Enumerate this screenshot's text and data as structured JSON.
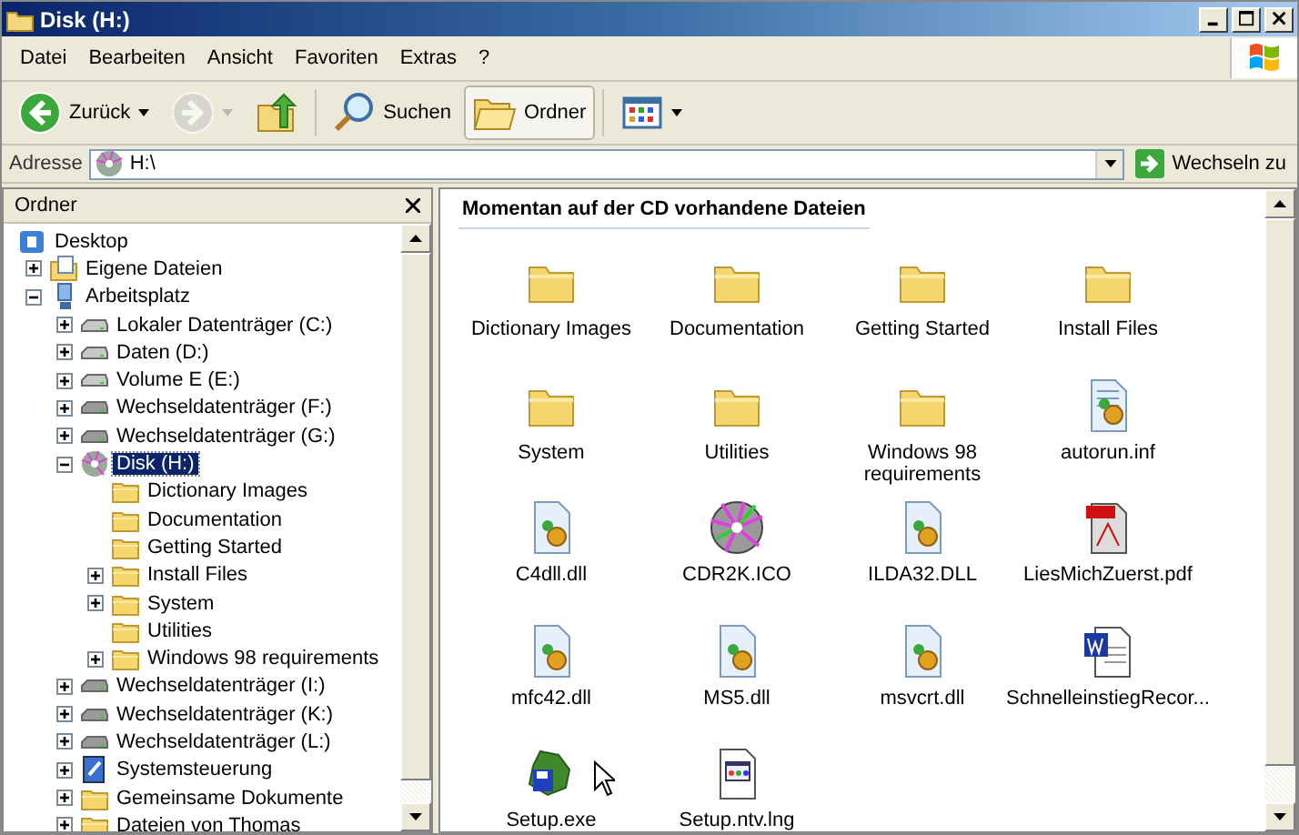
{
  "window": {
    "title": "Disk (H:)"
  },
  "menu": [
    "Datei",
    "Bearbeiten",
    "Ansicht",
    "Favoriten",
    "Extras",
    "?"
  ],
  "toolbar": [
    {
      "kind": "back",
      "label": "Zurück",
      "disabled": false,
      "pressed": false
    },
    {
      "kind": "forward",
      "disabled": true,
      "pressed": false
    },
    {
      "kind": "up",
      "disabled": false,
      "pressed": false
    },
    {
      "kind": "separator"
    },
    {
      "kind": "search",
      "label": "Suchen",
      "disabled": false,
      "pressed": false
    },
    {
      "kind": "folders",
      "label": "Ordner",
      "disabled": false,
      "pressed": true
    },
    {
      "kind": "separator"
    },
    {
      "kind": "views",
      "disabled": false,
      "pressed": false
    }
  ],
  "address": {
    "label": "Adresse",
    "value": "H:\\",
    "go": "Wechseln zu"
  },
  "folders_pane": {
    "title": "Ordner",
    "tree": [
      {
        "label": "Desktop",
        "kind": "desktop",
        "has_children": false,
        "selected": false,
        "children": [
          {
            "label": "Eigene Dateien",
            "kind": "mydocs",
            "has_children": true,
            "expanded": false,
            "selected": false
          },
          {
            "label": "Arbeitsplatz",
            "kind": "computer",
            "has_children": true,
            "expanded": true,
            "selected": false,
            "children": [
              {
                "label": "Lokaler Datenträger (C:)",
                "kind": "drive",
                "has_children": true,
                "expanded": false,
                "selected": false
              },
              {
                "label": "Daten (D:)",
                "kind": "drive",
                "has_children": true,
                "expanded": false,
                "selected": false
              },
              {
                "label": "Volume E (E:)",
                "kind": "drive",
                "has_children": true,
                "expanded": false,
                "selected": false
              },
              {
                "label": "Wechseldatenträger (F:)",
                "kind": "removable",
                "has_children": true,
                "expanded": false,
                "selected": false
              },
              {
                "label": "Wechseldatenträger (G:)",
                "kind": "removable",
                "has_children": true,
                "expanded": false,
                "selected": false
              },
              {
                "label": "Disk (H:)",
                "kind": "cd",
                "has_children": true,
                "expanded": true,
                "selected": true,
                "children": [
                  {
                    "label": "Dictionary Images",
                    "kind": "folder",
                    "has_children": false,
                    "selected": false
                  },
                  {
                    "label": "Documentation",
                    "kind": "folder",
                    "has_children": false,
                    "selected": false
                  },
                  {
                    "label": "Getting Started",
                    "kind": "folder",
                    "has_children": false,
                    "selected": false
                  },
                  {
                    "label": "Install Files",
                    "kind": "folder",
                    "has_children": true,
                    "expanded": false,
                    "selected": false
                  },
                  {
                    "label": "System",
                    "kind": "folder",
                    "has_children": true,
                    "expanded": false,
                    "selected": false
                  },
                  {
                    "label": "Utilities",
                    "kind": "folder",
                    "has_children": false,
                    "selected": false
                  },
                  {
                    "label": "Windows 98 requirements",
                    "kind": "folder",
                    "has_children": true,
                    "expanded": false,
                    "selected": false
                  }
                ]
              },
              {
                "label": "Wechseldatenträger (I:)",
                "kind": "removable",
                "has_children": true,
                "expanded": false,
                "selected": false
              },
              {
                "label": "Wechseldatenträger (K:)",
                "kind": "removable",
                "has_children": true,
                "expanded": false,
                "selected": false
              },
              {
                "label": "Wechseldatenträger (L:)",
                "kind": "removable",
                "has_children": true,
                "expanded": false,
                "selected": false
              },
              {
                "label": "Systemsteuerung",
                "kind": "control",
                "has_children": true,
                "expanded": false,
                "selected": false
              },
              {
                "label": "Gemeinsame Dokumente",
                "kind": "folder",
                "has_children": true,
                "expanded": false,
                "selected": false
              },
              {
                "label": "Dateien von Thomas",
                "kind": "folder",
                "has_children": true,
                "expanded": false,
                "selected": false
              }
            ]
          }
        ]
      }
    ]
  },
  "content": {
    "heading": "Momentan auf der CD vorhandene Dateien",
    "files": [
      {
        "name": "Dictionary Images",
        "kind": "folder"
      },
      {
        "name": "Documentation",
        "kind": "folder"
      },
      {
        "name": "Getting Started",
        "kind": "folder"
      },
      {
        "name": "Install Files",
        "kind": "folder"
      },
      {
        "name": "System",
        "kind": "folder"
      },
      {
        "name": "Utilities",
        "kind": "folder"
      },
      {
        "name": "Windows 98 requirements",
        "kind": "folder"
      },
      {
        "name": "autorun.inf",
        "kind": "inf"
      },
      {
        "name": "C4dll.dll",
        "kind": "dll"
      },
      {
        "name": "CDR2K.ICO",
        "kind": "cd"
      },
      {
        "name": "ILDA32.DLL",
        "kind": "dll"
      },
      {
        "name": "LiesMichZuerst.pdf",
        "kind": "pdf"
      },
      {
        "name": "mfc42.dll",
        "kind": "dll"
      },
      {
        "name": "MS5.dll",
        "kind": "dll"
      },
      {
        "name": "msvcrt.dll",
        "kind": "dll"
      },
      {
        "name": "SchnelleinstiegRecor...",
        "kind": "doc"
      },
      {
        "name": "Setup.exe",
        "kind": "setup"
      },
      {
        "name": "Setup.ntv.lng",
        "kind": "lng"
      }
    ]
  }
}
